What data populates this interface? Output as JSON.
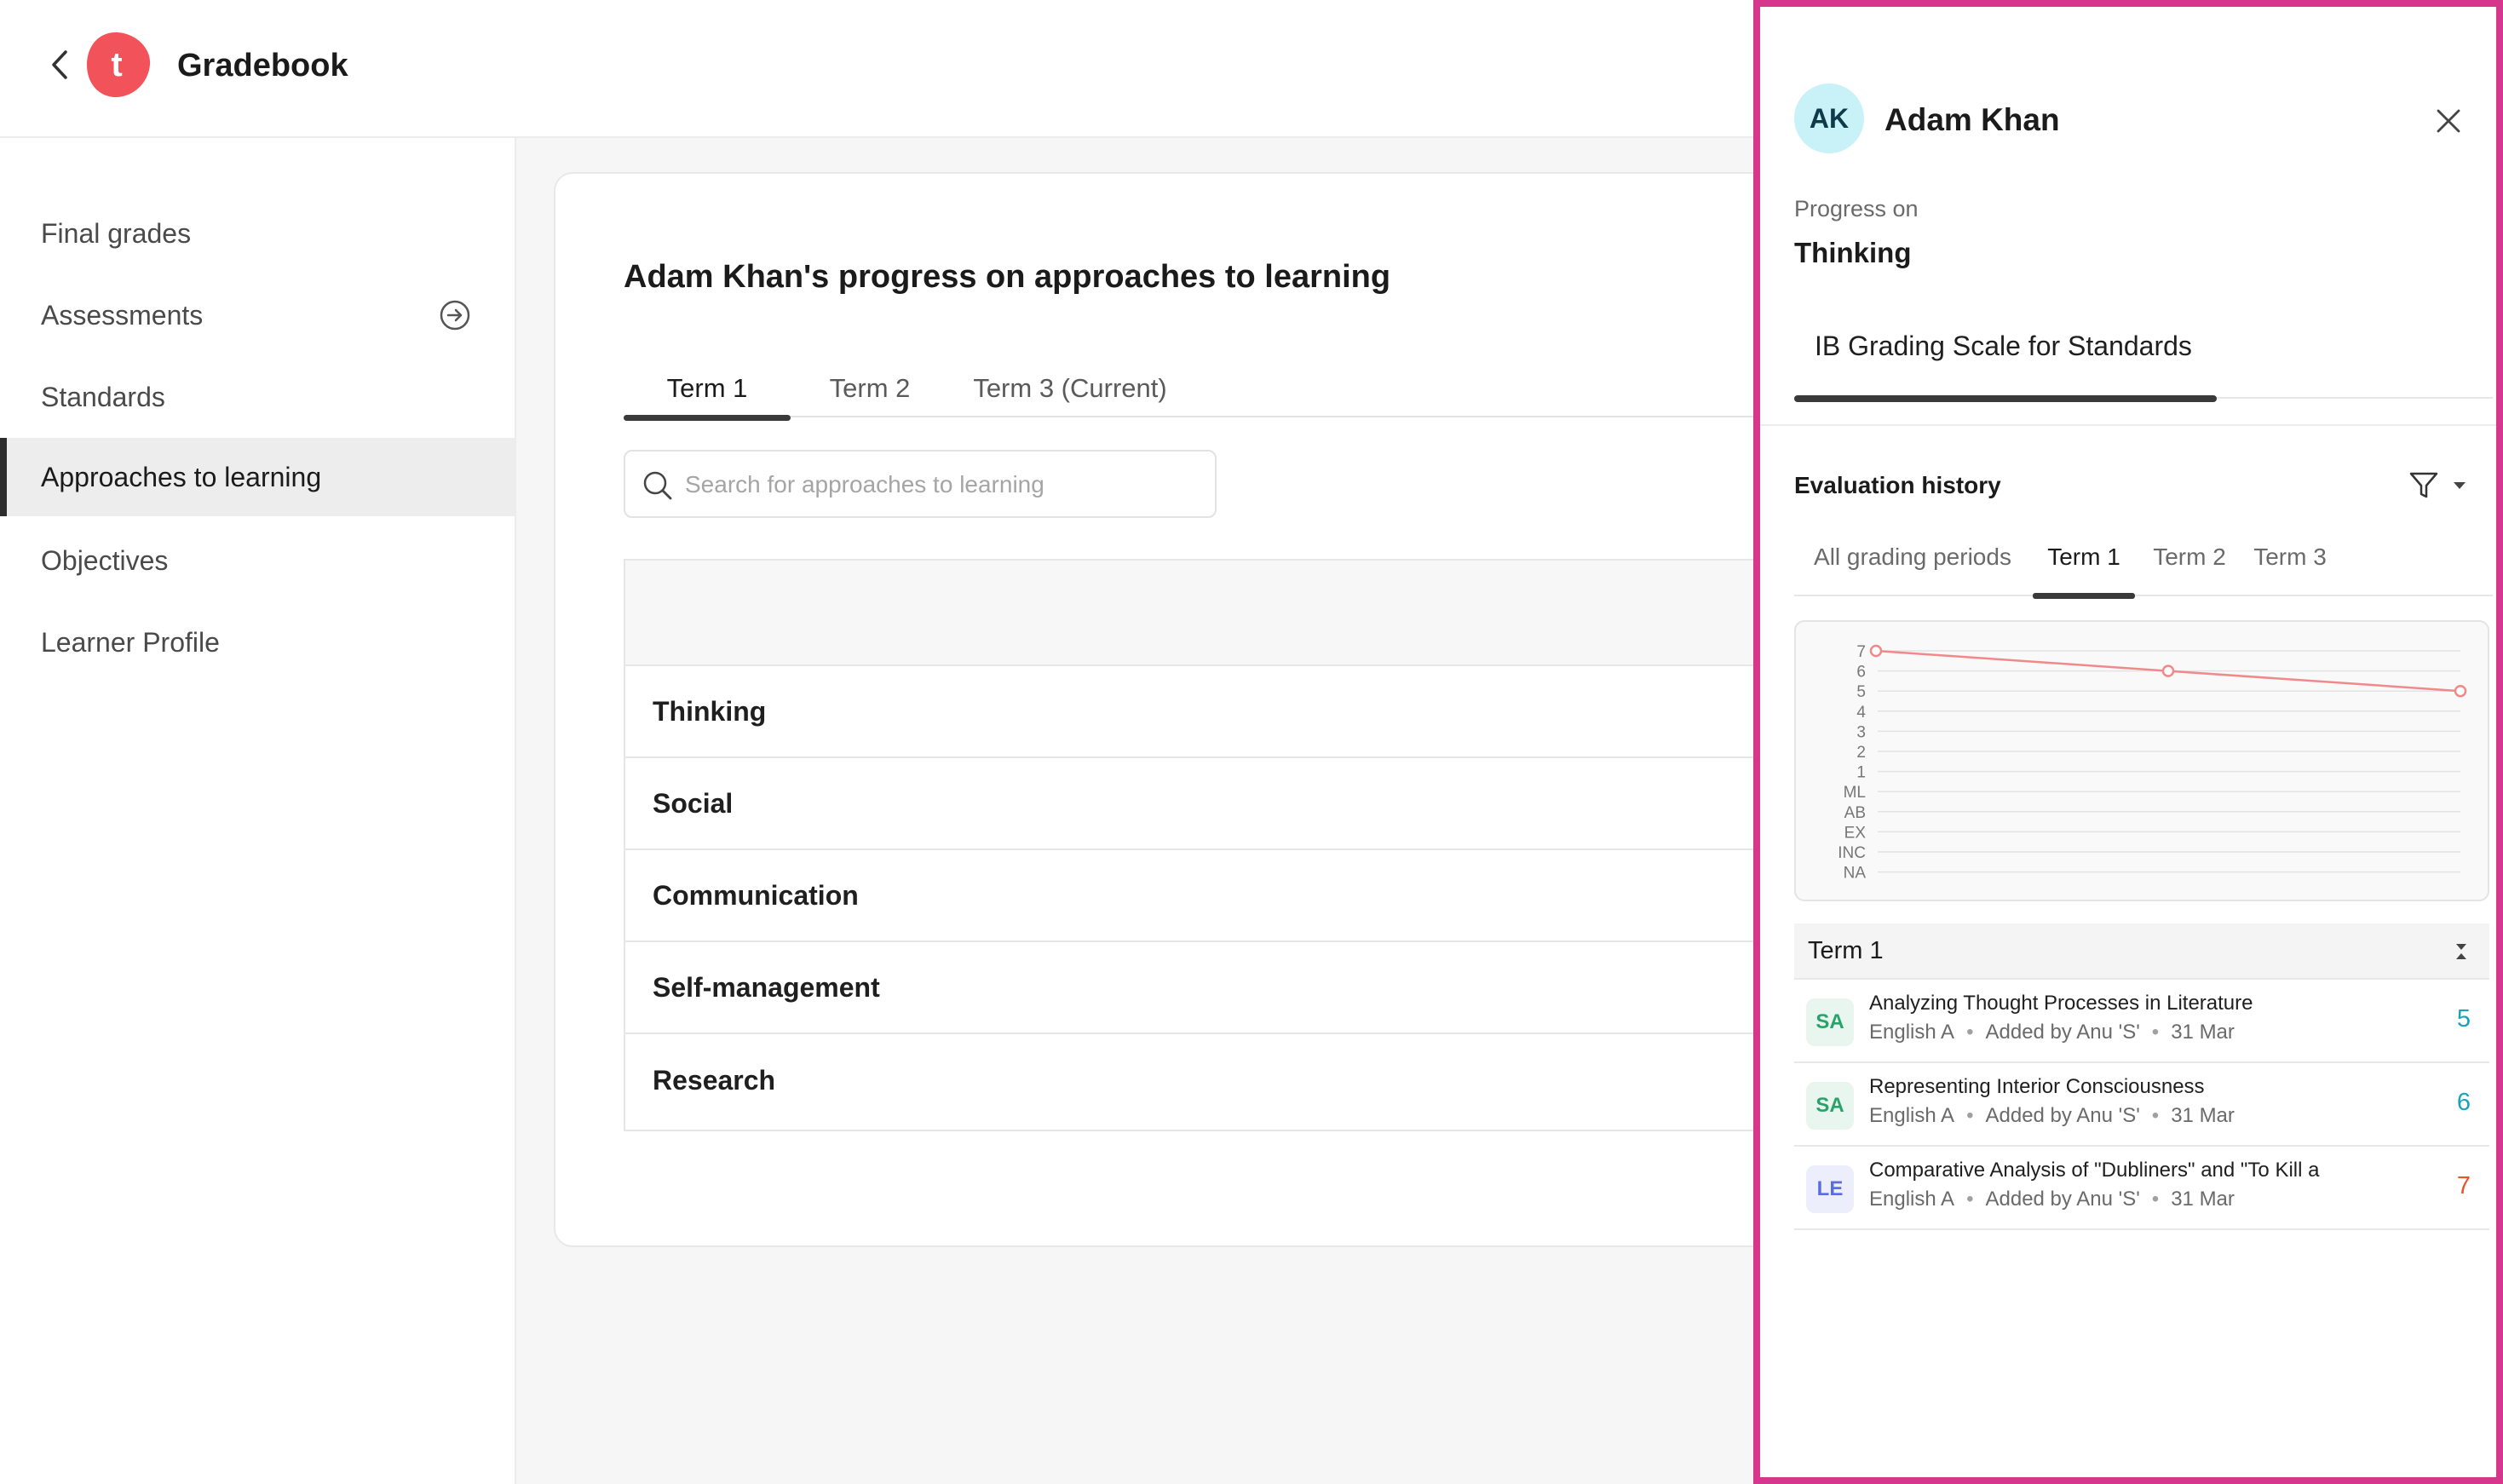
{
  "header": {
    "back_icon": "chevron-left-icon",
    "logo_letter": "t",
    "logo_color": "#f2525a",
    "title": "Gradebook"
  },
  "sidebar": {
    "items": [
      {
        "label": "Final grades",
        "active": false
      },
      {
        "label": "Assessments",
        "active": false,
        "icon": "arrow-circle-right-icon"
      },
      {
        "label": "Standards",
        "active": false
      },
      {
        "label": "Approaches to learning",
        "active": true
      },
      {
        "label": "Objectives",
        "active": false
      },
      {
        "label": "Learner Profile",
        "active": false
      }
    ]
  },
  "main": {
    "title": "Adam Khan's progress on approaches to learning",
    "tabs": [
      {
        "label": "Term 1",
        "active": true
      },
      {
        "label": "Term 2",
        "active": false
      },
      {
        "label": "Term 3 (Current)",
        "active": false
      }
    ],
    "search": {
      "placeholder": "Search for approaches to learning",
      "value": ""
    },
    "rows": [
      "Thinking",
      "Social",
      "Communication",
      "Self-management",
      "Research"
    ]
  },
  "panel": {
    "border_color": "#d6378c",
    "avatar_initials": "AK",
    "student_name": "Adam Khan",
    "progress_label": "Progress on",
    "progress_subject": "Thinking",
    "scale_tab": "IB Grading Scale for Standards",
    "evaluation_title": "Evaluation history",
    "period_tabs": [
      {
        "label": "All grading periods",
        "active": false
      },
      {
        "label": "Term 1",
        "active": true
      },
      {
        "label": "Term 2",
        "active": false
      },
      {
        "label": "Term 3",
        "active": false
      }
    ],
    "term_header": "Term 1",
    "evaluations": [
      {
        "badge": "SA",
        "type": "sa",
        "title": "Analyzing Thought Processes in Literature",
        "subject": "English A",
        "added_by": "Added by Anu 'S'",
        "date": "31 Mar",
        "score": "5",
        "score_color": "#1aa3b8"
      },
      {
        "badge": "SA",
        "type": "sa",
        "title": "Representing Interior Consciousness",
        "subject": "English A",
        "added_by": "Added by Anu 'S'",
        "date": "31 Mar",
        "score": "6",
        "score_color": "#1aa3b8"
      },
      {
        "badge": "LE",
        "type": "le",
        "title": "Comparative Analysis of \"Dubliners\" and \"To Kill a",
        "subject": "English A",
        "added_by": "Added by Anu 'S'",
        "date": "31 Mar",
        "score": "7",
        "score_color": "#e8532a"
      }
    ]
  },
  "chart_data": {
    "type": "line",
    "y_categories": [
      "NA",
      "INC",
      "EX",
      "AB",
      "ML",
      "1",
      "2",
      "3",
      "4",
      "5",
      "6",
      "7"
    ],
    "series": [
      {
        "values": [
          "7",
          "6",
          "5"
        ]
      }
    ],
    "line_color": "#f08a8a",
    "grid": true
  }
}
